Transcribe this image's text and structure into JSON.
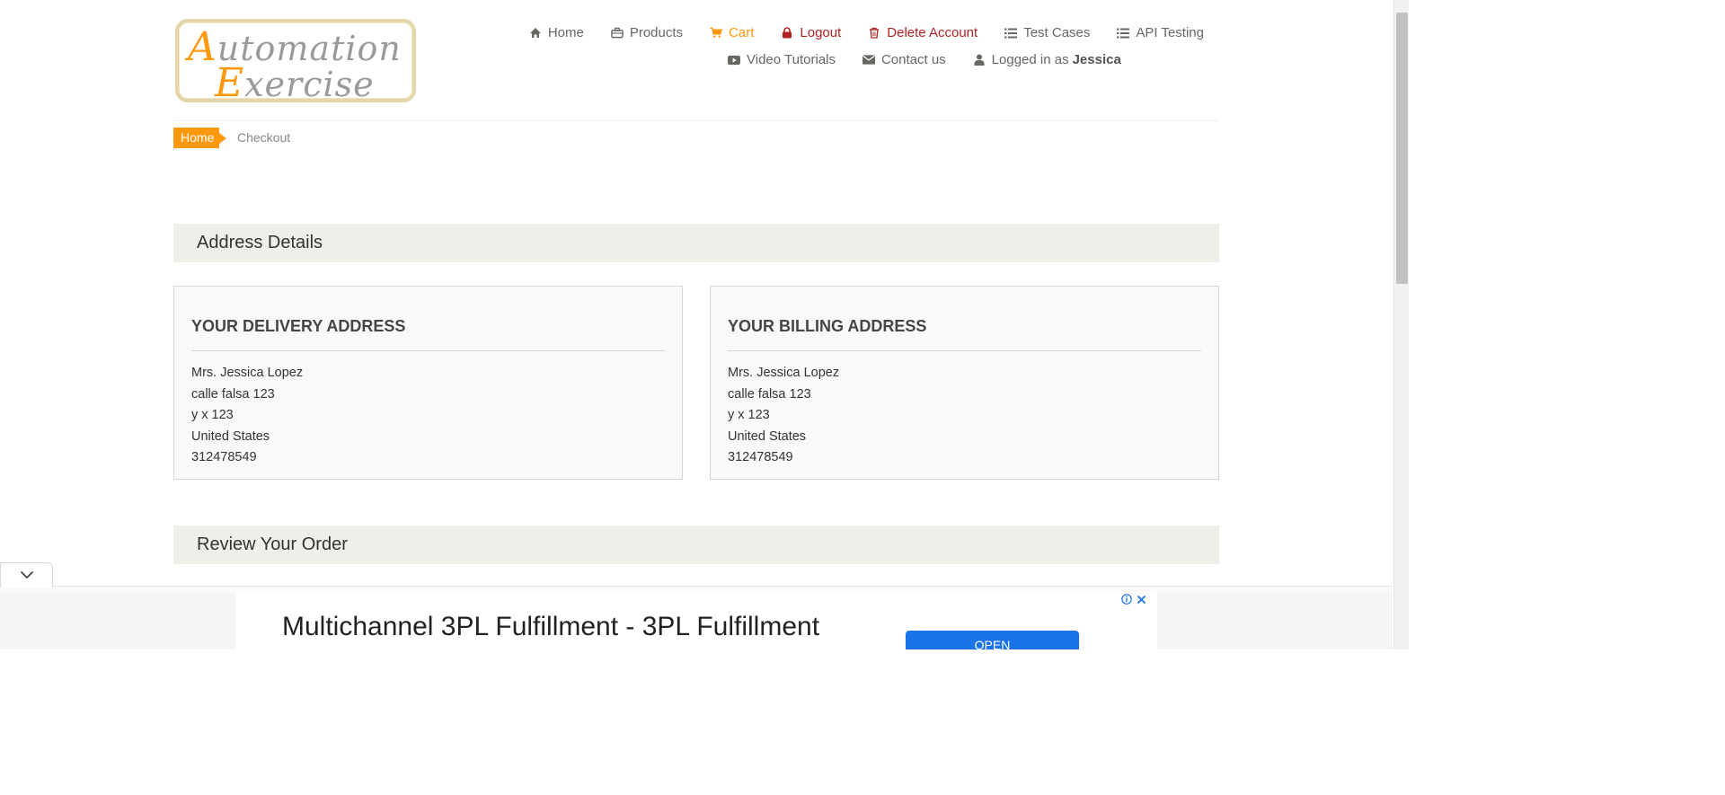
{
  "logo": {
    "line1_cap": "A",
    "line1_rest": "utomation",
    "line2_cap": "E",
    "line2_rest": "xercise"
  },
  "nav": {
    "row1": [
      {
        "label": "Home",
        "icon": "home-icon"
      },
      {
        "label": "Products",
        "icon": "briefcase-icon"
      },
      {
        "label": "Cart",
        "icon": "cart-icon"
      },
      {
        "label": "Logout",
        "icon": "lock-icon"
      },
      {
        "label": "Delete Account",
        "icon": "trash-icon"
      },
      {
        "label": "Test Cases",
        "icon": "list-icon"
      },
      {
        "label": "API Testing",
        "icon": "list-icon"
      }
    ],
    "row2": [
      {
        "label": "Video Tutorials",
        "icon": "youtube-play-icon"
      },
      {
        "label": "Contact us",
        "icon": "envelope-icon"
      },
      {
        "label": "Logged in as",
        "icon": "user-icon",
        "user": "Jessica"
      }
    ]
  },
  "breadcrumb": {
    "home": "Home",
    "current": "Checkout"
  },
  "address_section": {
    "title": "Address Details"
  },
  "delivery": {
    "heading": "YOUR DELIVERY ADDRESS",
    "lines": [
      "Mrs. Jessica Lopez",
      "calle falsa 123",
      "y x 123",
      "United States",
      "312478549"
    ]
  },
  "billing": {
    "heading": "YOUR BILLING ADDRESS",
    "lines": [
      "Mrs. Jessica Lopez",
      "calle falsa 123",
      "y x 123",
      "United States",
      "312478549"
    ]
  },
  "review_section": {
    "title": "Review Your Order"
  },
  "ad": {
    "headline": "Multichannel 3PL Fulfillment - 3PL Fulfillment",
    "button": "OPEN"
  },
  "colors": {
    "accent": "#fe980f",
    "danger": "#b22222",
    "section_bg": "#efeee8",
    "ad_button": "#1a73e8"
  }
}
